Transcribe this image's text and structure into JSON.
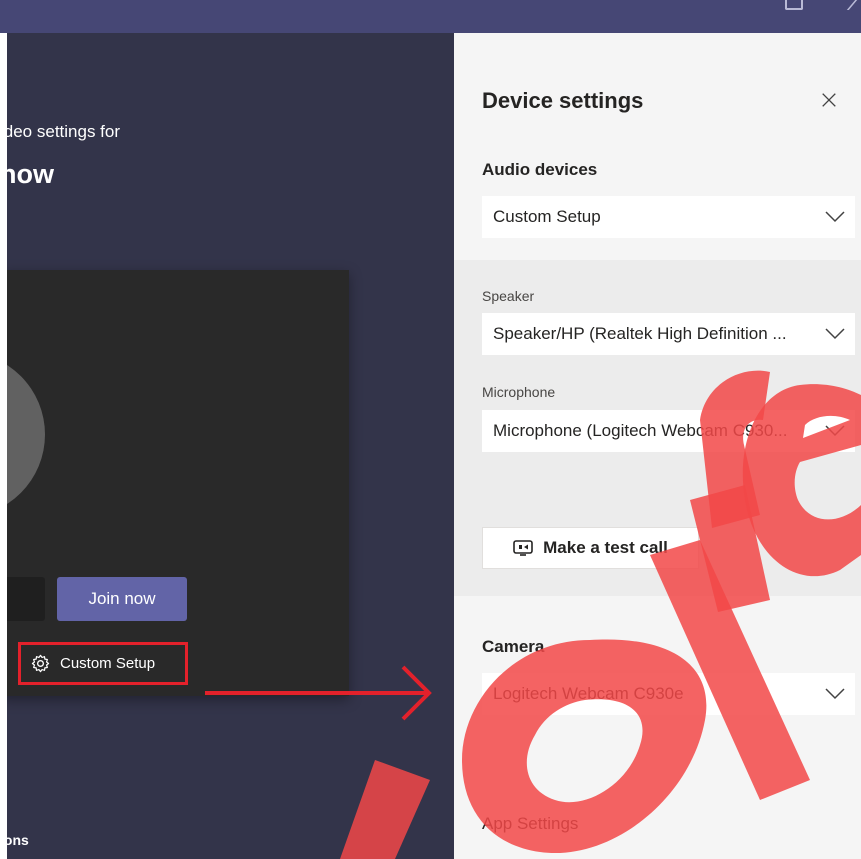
{
  "header": {
    "icons": [
      "compose-icon",
      "close-icon"
    ]
  },
  "left_pane": {
    "subtitle": "ideo settings for",
    "heading": "now",
    "join_label": "Join now",
    "custom_setup_label": "Custom Setup",
    "bottom_text": "ions"
  },
  "device_settings": {
    "title": "Device settings",
    "audio_devices": {
      "label": "Audio devices",
      "value": "Custom Setup"
    },
    "speaker": {
      "label": "Speaker",
      "value": "Speaker/HP (Realtek High Definition ..."
    },
    "microphone": {
      "label": "Microphone",
      "value": "Microphone (Logitech Webcam C930..."
    },
    "test_call_label": "Make a test call",
    "camera": {
      "label": "Camera",
      "value": "Logitech Webcam C930e"
    },
    "app_settings_label": "App Settings"
  },
  "colors": {
    "accent": "#6264a7",
    "topbar": "#464775",
    "left_bg": "#33344a",
    "annotation_red": "#e3212b",
    "watermark": "#f24848"
  }
}
